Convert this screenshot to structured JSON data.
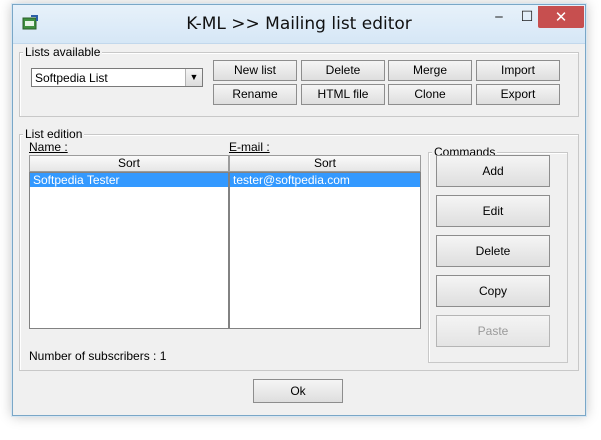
{
  "window": {
    "title": "K-ML >> Mailing list editor",
    "controls": {
      "minimize": "‒",
      "maximize": "☐",
      "close": "✕"
    }
  },
  "lists_available": {
    "legend": "Lists available",
    "selected_list": "Softpedia List",
    "buttons": {
      "new_list": "New list",
      "delete": "Delete",
      "merge": "Merge",
      "import": "Import",
      "rename": "Rename",
      "html_file": "HTML file",
      "clone": "Clone",
      "export": "Export"
    }
  },
  "list_edition": {
    "legend": "List edition",
    "columns": {
      "name_label": "Name :",
      "email_label": "E-mail :",
      "sort_label": "Sort"
    },
    "name_items": [
      "Softpedia Tester"
    ],
    "email_items": [
      "tester@softpedia.com"
    ],
    "status": "Number of subscribers : 1"
  },
  "commands": {
    "legend": "Commands",
    "add": "Add",
    "edit": "Edit",
    "delete": "Delete",
    "copy": "Copy",
    "paste": "Paste"
  },
  "footer": {
    "ok": "Ok"
  },
  "colors": {
    "selection": "#3399ff",
    "close_button": "#c74f4f",
    "title_bar": "#d6e7f6"
  }
}
